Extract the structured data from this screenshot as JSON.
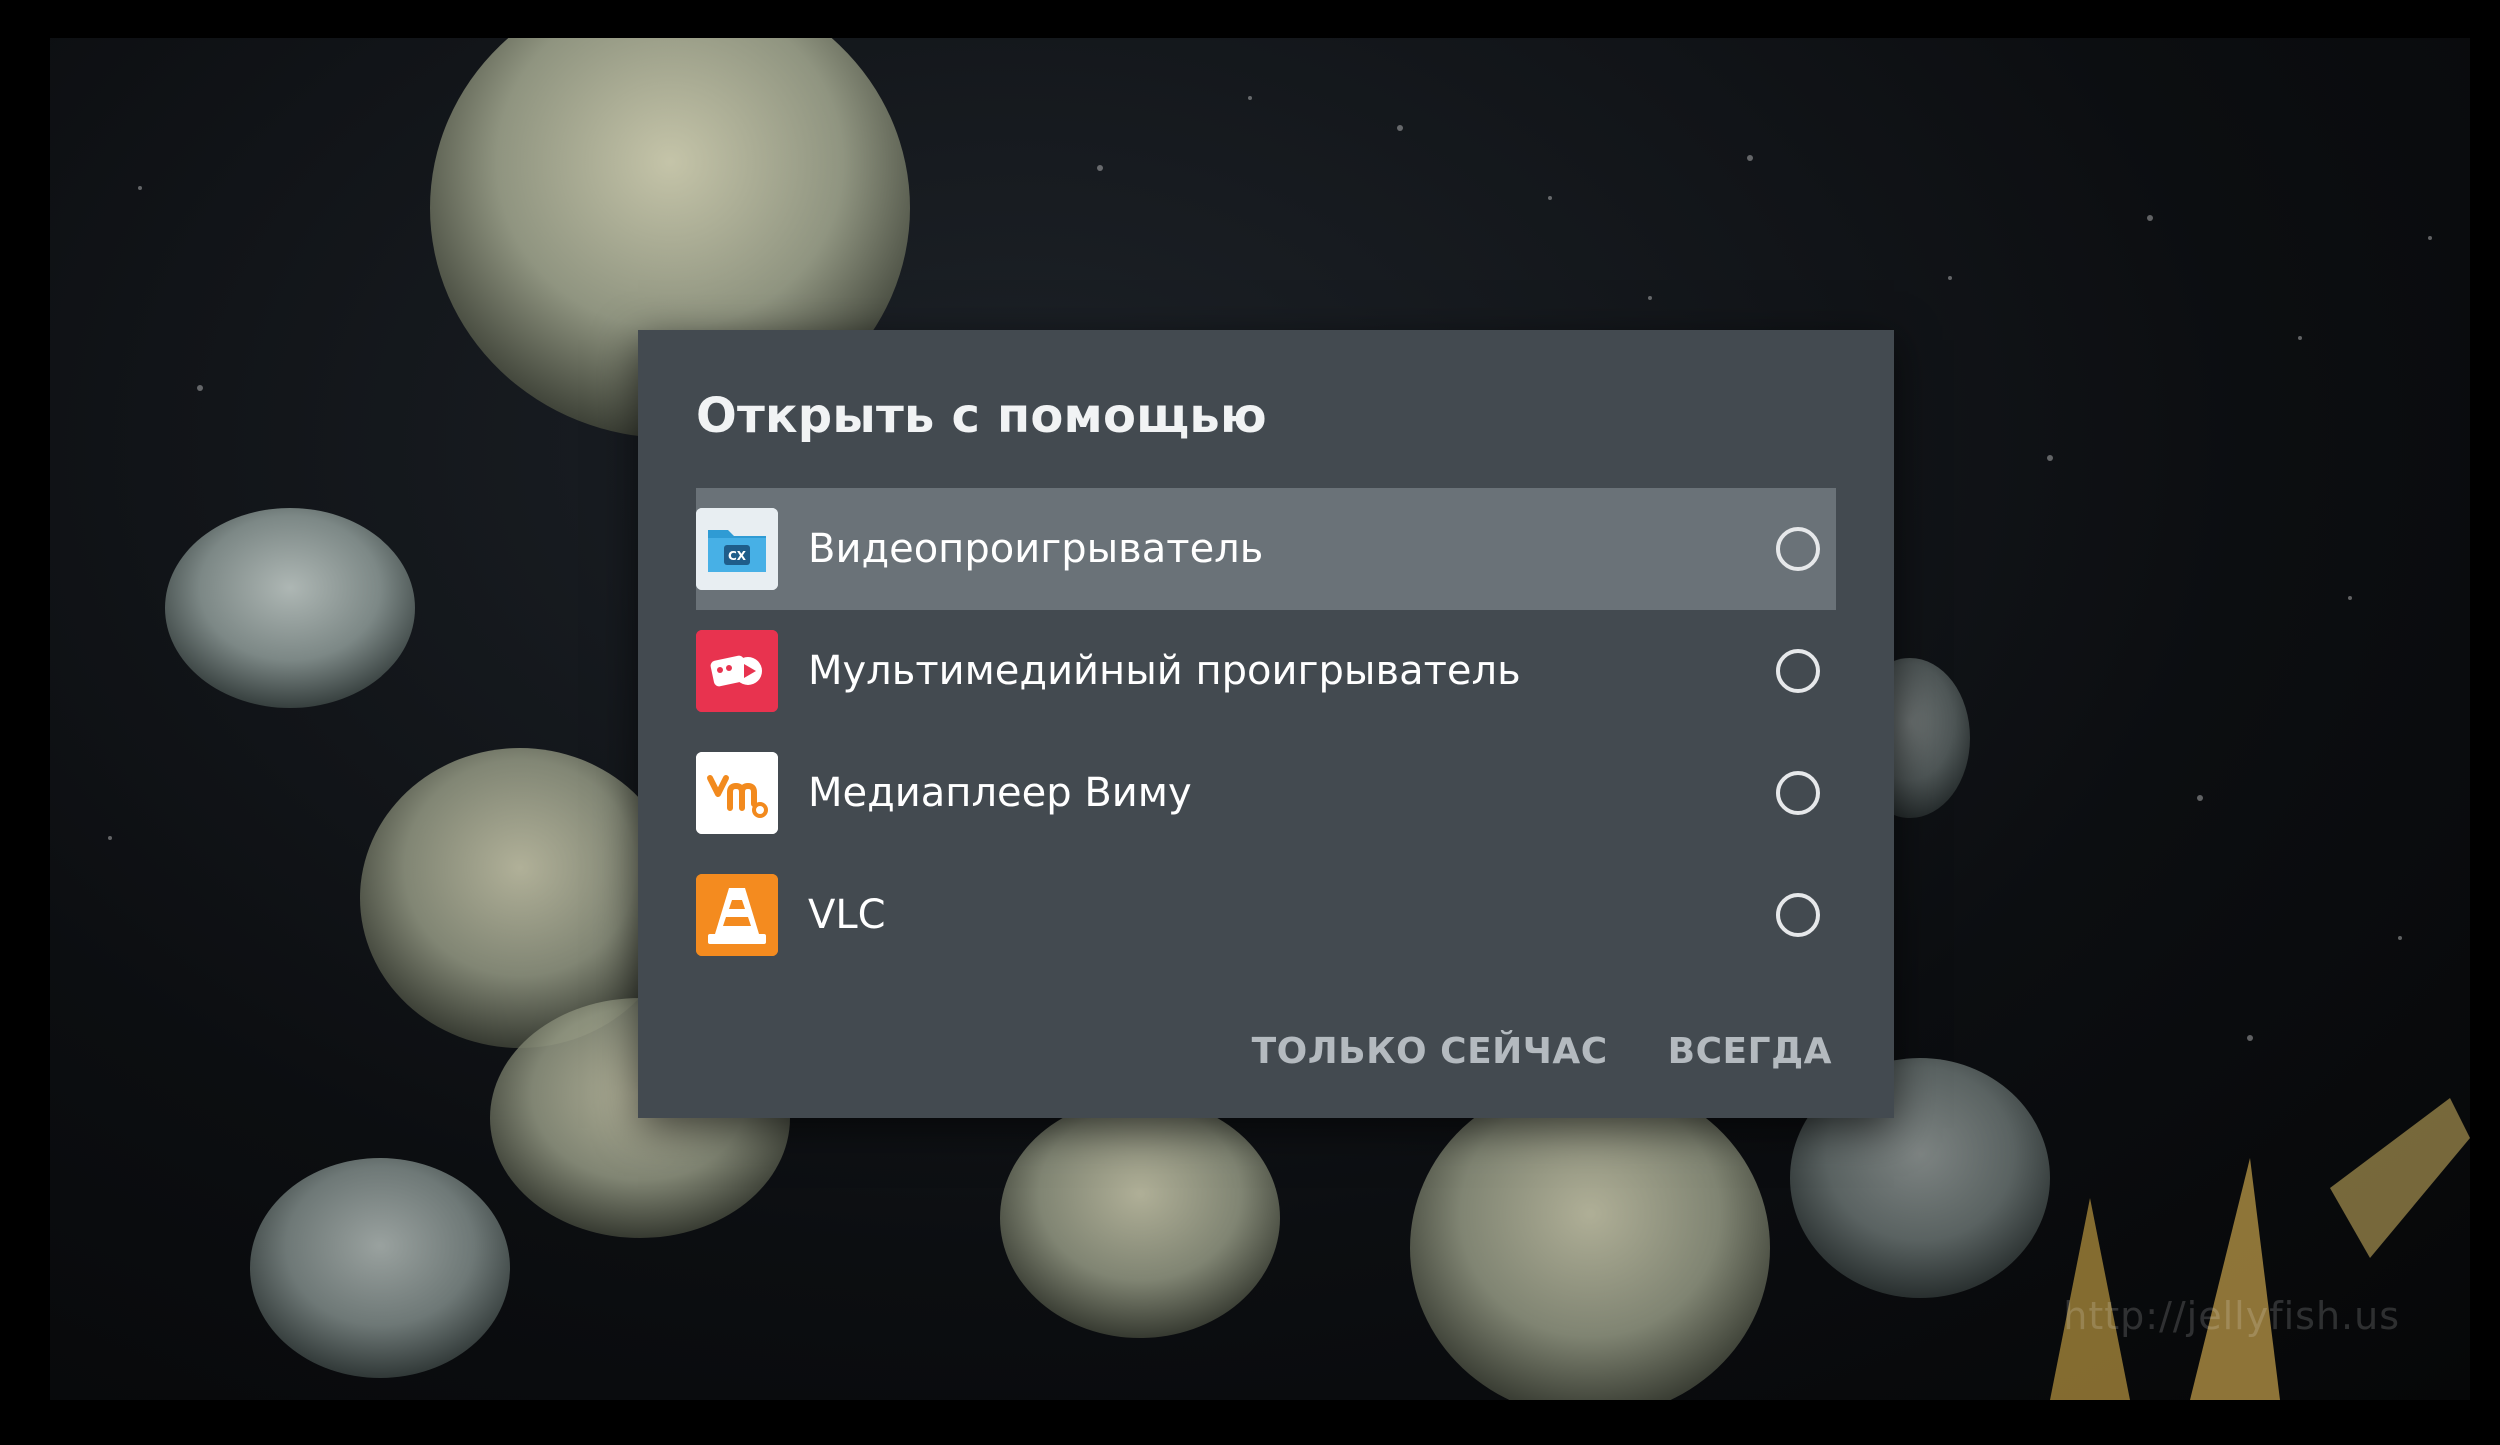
{
  "dialog": {
    "title": "Открыть с помощью",
    "apps": [
      {
        "label": "Видеопроигрыватель",
        "icon": "folder-cx-icon",
        "selected": true
      },
      {
        "label": "Мультимедийный проигрыватель",
        "icon": "multimedia-player-icon",
        "selected": false
      },
      {
        "label": "Медиаплеер Виму",
        "icon": "vimu-icon",
        "selected": false
      },
      {
        "label": "VLC",
        "icon": "vlc-cone-icon",
        "selected": false
      }
    ],
    "buttons": {
      "just_once": "ТОЛЬКО СЕЙЧАС",
      "always": "ВСЕГДА"
    }
  },
  "watermark": "http://jellyfish.us",
  "colors": {
    "dialog_bg": "#434a50",
    "selected_bg": "#6a7278",
    "button_text": "#b4babf"
  }
}
